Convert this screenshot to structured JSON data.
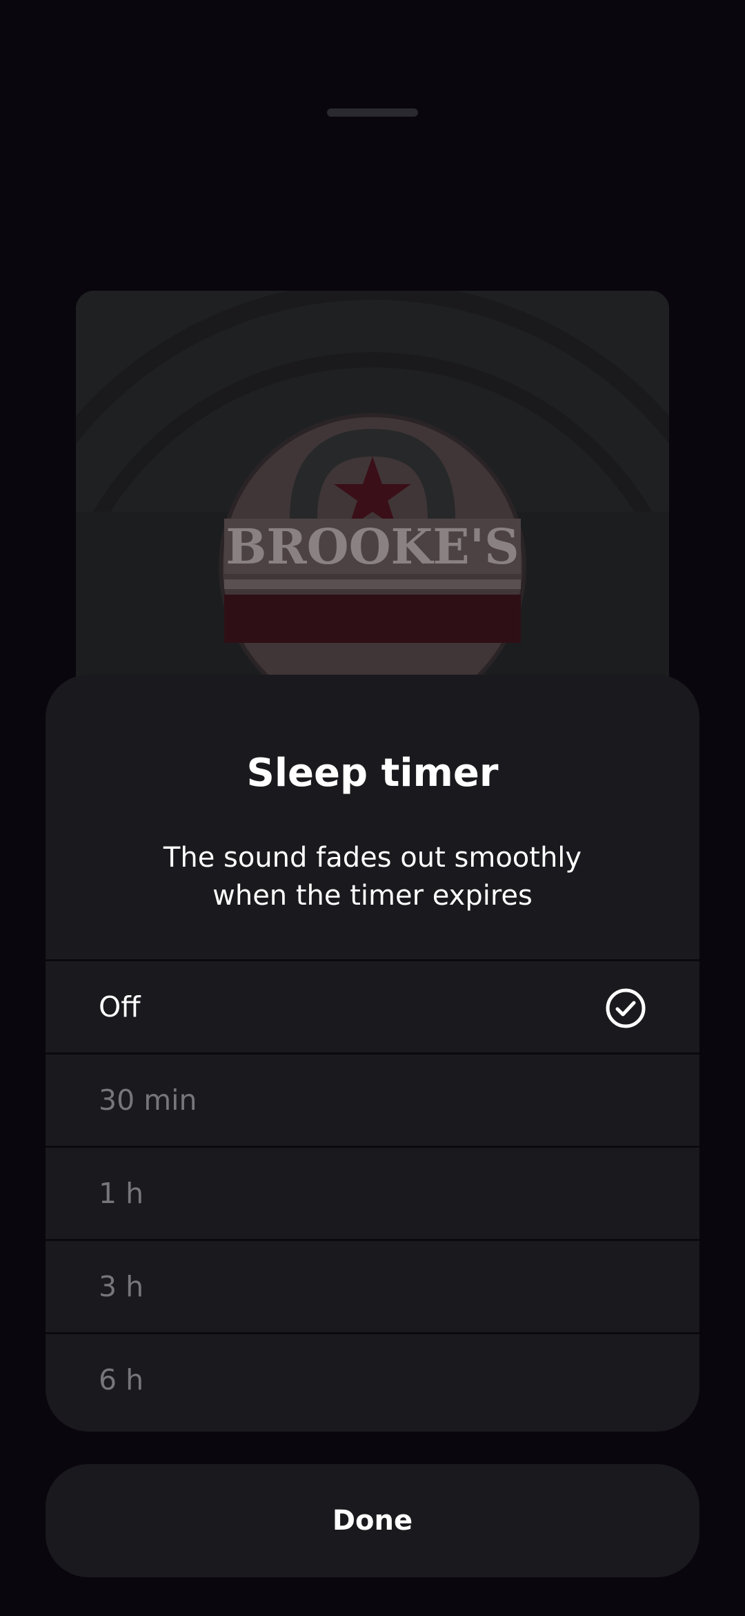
{
  "sheet": {
    "title": "Sleep timer",
    "subtitle": "The sound fades out smoothly\nwhen the timer expires"
  },
  "options": [
    {
      "label": "Off",
      "selected": true
    },
    {
      "label": "30 min",
      "selected": false
    },
    {
      "label": "1 h",
      "selected": false
    },
    {
      "label": "3 h",
      "selected": false
    },
    {
      "label": "6 h",
      "selected": false
    }
  ],
  "artwork": {
    "sign_text": "BROOKE'S"
  },
  "done_label": "Done",
  "icons": {
    "selected_option": "check-circle-icon"
  },
  "colors": {
    "background": "#09060d",
    "sheet": "#1a191d",
    "text_primary": "#ffffff",
    "text_secondary": "#77767b",
    "divider": "#0b090e"
  }
}
